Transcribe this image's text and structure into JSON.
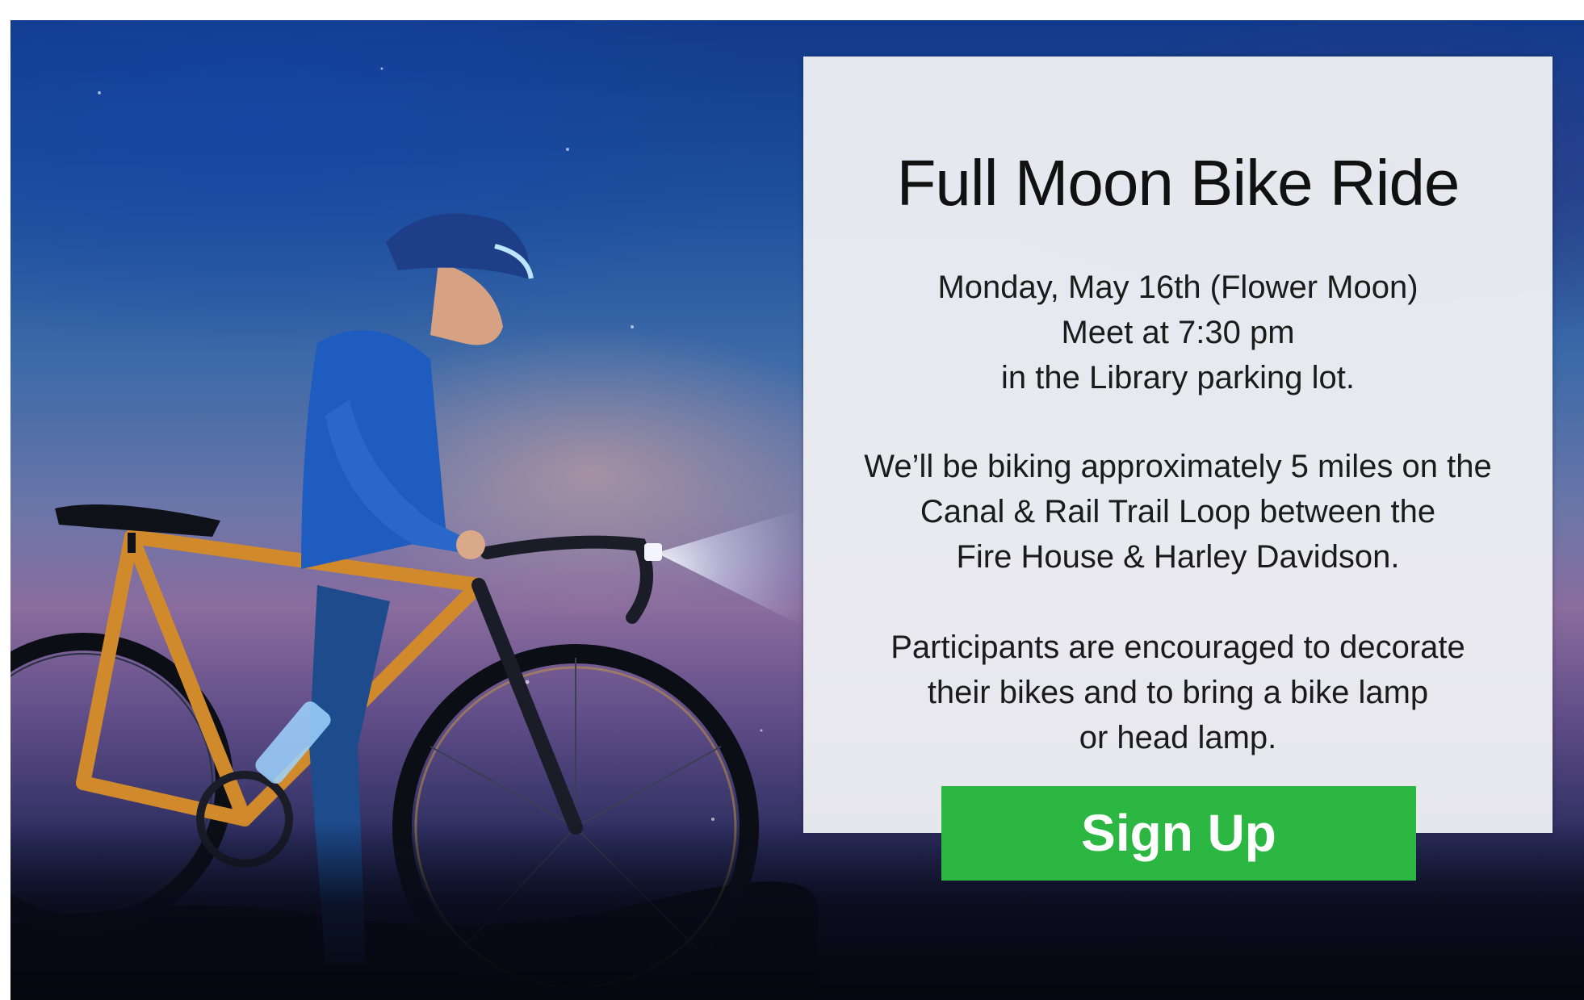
{
  "event": {
    "title": "Full Moon Bike Ride",
    "details": [
      "Monday, May 16th (Flower Moon)",
      "Meet at 7:30 pm",
      "in the Library parking lot."
    ],
    "route": [
      "We’ll be biking approximately 5 miles on the",
      "Canal & Rail Trail Loop between the",
      "Fire House & Harley Davidson."
    ],
    "note": [
      "Participants are encouraged to decorate",
      "their bikes and to bring a bike lamp",
      "or head lamp."
    ]
  },
  "cta": {
    "label": "Sign Up",
    "color": "#2cb742"
  },
  "colors": {
    "card_bg": "#ecedf2",
    "sky_top": "#123a8a",
    "sky_mid": "#8a6c9e",
    "ground": "#05070f"
  }
}
